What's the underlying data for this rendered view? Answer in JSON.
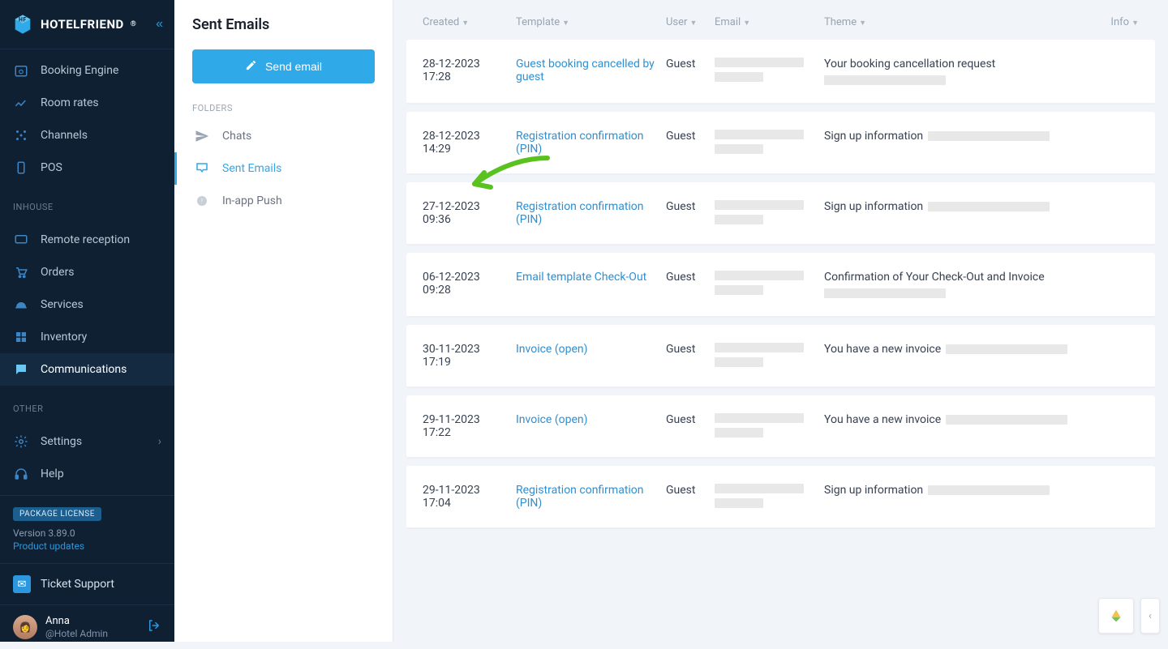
{
  "brand": "HOTELFRIEND",
  "nav": {
    "booking_engine": "Booking Engine",
    "room_rates": "Room rates",
    "channels": "Channels",
    "pos": "POS",
    "inhouse_label": "INHOUSE",
    "remote_reception": "Remote reception",
    "orders": "Orders",
    "services": "Services",
    "inventory": "Inventory",
    "communications": "Communications",
    "other_label": "OTHER",
    "settings": "Settings",
    "help": "Help"
  },
  "footer": {
    "license": "PACKAGE LICENSE",
    "version": "Version 3.89.0",
    "updates": "Product updates",
    "ticket": "Ticket Support"
  },
  "user": {
    "name": "Anna",
    "role": "@Hotel Admin"
  },
  "page_title": "Sent Emails",
  "send_btn": "Send email",
  "folders_label": "FOLDERS",
  "folders": {
    "chats": "Chats",
    "sent": "Sent Emails",
    "push": "In-app Push"
  },
  "columns": {
    "created": "Created",
    "template": "Template",
    "user": "User",
    "email": "Email",
    "theme": "Theme",
    "info": "Info"
  },
  "rows": [
    {
      "created": "28-12-2023 17:28",
      "template": "Guest booking cancelled by guest",
      "user": "Guest",
      "theme": "Your booking cancellation request"
    },
    {
      "created": "28-12-2023 14:29",
      "template": "Registration confirmation (PIN)",
      "user": "Guest",
      "theme": "Sign up information"
    },
    {
      "created": "27-12-2023 09:36",
      "template": "Registration confirmation (PIN)",
      "user": "Guest",
      "theme": "Sign up information"
    },
    {
      "created": "06-12-2023 09:28",
      "template": "Email template Check-Out",
      "user": "Guest",
      "theme": "Confirmation of Your Check-Out and Invoice"
    },
    {
      "created": "30-11-2023 17:19",
      "template": "Invoice (open)",
      "user": "Guest",
      "theme": "You have a new invoice"
    },
    {
      "created": "29-11-2023 17:22",
      "template": "Invoice (open)",
      "user": "Guest",
      "theme": "You have a new invoice"
    },
    {
      "created": "29-11-2023 17:04",
      "template": "Registration confirmation (PIN)",
      "user": "Guest",
      "theme": "Sign up information"
    }
  ]
}
